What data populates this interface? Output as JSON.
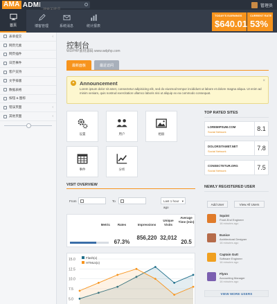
{
  "app": {
    "brand_part1": "AMA",
    "brand_part2": "ADMIN",
    "search_placeholder": "搜索关键词",
    "user_name": "管理员"
  },
  "nav": [
    {
      "label": "首页",
      "icon": "monitor-icon",
      "active": true
    },
    {
      "label": "博客管理",
      "icon": "pen-icon",
      "active": false
    },
    {
      "label": "系统消息",
      "icon": "envelope-icon",
      "active": false
    },
    {
      "label": "统计报表",
      "icon": "bar-chart-icon",
      "active": false
    }
  ],
  "stats": {
    "earnings_label": "TODAY'S EARNINGS",
    "earnings_value": "$640.01",
    "rate_label": "CURRENT RATE",
    "rate_value": "53%"
  },
  "sidebar": {
    "items": [
      {
        "label": "表单提交",
        "caret": "‹"
      },
      {
        "label": "网页元素",
        "caret": ""
      },
      {
        "label": "网页插件",
        "caret": ""
      },
      {
        "label": "日历事件",
        "caret": ""
      },
      {
        "label": "客户支持",
        "caret": ""
      },
      {
        "label": "文字排版",
        "caret": ""
      },
      {
        "label": "数据表格",
        "caret": ""
      },
      {
        "label": "按钮 & 图标",
        "caret": ""
      },
      {
        "label": "错误页面",
        "caret": "‹"
      },
      {
        "label": "其他页面",
        "caret": "‹"
      }
    ]
  },
  "page": {
    "title": "控制台",
    "subtitle": "WDPHP素材源码 www.wdphp.com",
    "tabs": [
      {
        "label": "最新面板",
        "active": true
      },
      {
        "label": "最近访问",
        "active": false
      }
    ]
  },
  "announcement": {
    "title": "Announcement",
    "text": "Lorem ipsum dolor sit amet, consectetur adipisicing elit, sed do eiusmod tempor incididunt ut labore et dolore magna aliqua. Ut enim ad minim veniam, quis nostrud exercitation ullamco laboris nisi ut aliquip ex ea commodo consequat.",
    "close": "×"
  },
  "shortcuts": [
    {
      "label": "设置",
      "icon": "gears-icon"
    },
    {
      "label": "用户",
      "icon": "users-icon"
    },
    {
      "label": "相册",
      "icon": "picture-icon"
    },
    {
      "label": "事件",
      "icon": "calendar-icon"
    },
    {
      "label": "分析",
      "icon": "line-chart-icon"
    }
  ],
  "top_sites": {
    "title": "TOP RATED SITES",
    "items": [
      {
        "name": "LOREMIPSUM.COM",
        "network": "Social Network",
        "score": "8.1"
      },
      {
        "name": "DOLORSITAMET.NET",
        "network": "Social Network",
        "score": "7.8"
      },
      {
        "name": "CONSECTETUR.ORG",
        "network": "Social Network",
        "score": "7.5"
      }
    ]
  },
  "new_users": {
    "title": "NEWLY REGISTERED USER",
    "add_label": "Add User",
    "view_all_label": "View All Users",
    "users": [
      {
        "name": "Squint",
        "role": "Front-End Engineer",
        "time": "16 minutes ago",
        "color": "#e07b2a"
      },
      {
        "name": "Eunice",
        "role": "Architectural Designer",
        "time": "16 minutes ago",
        "color": "#b56b4a"
      },
      {
        "name": "Captain Gutt",
        "role": "Software Engineer",
        "time": "16 minutes ago",
        "color": "#f0a020"
      },
      {
        "name": "Flynn",
        "role": "Accounting Manager",
        "time": "16 minutes ago",
        "color": "#7b5fb0"
      }
    ],
    "view_more": "VIEW MORE USERS"
  },
  "visit_overview": {
    "title": "VISIT OVERVIEW",
    "from_label": "From",
    "to_label": "To",
    "range_select": "Last 1 hour ago",
    "headers": [
      "Metric",
      "Rates",
      "Impressions",
      "Unique Visits",
      "Average Time (min)"
    ],
    "rates": "67.3%",
    "rates_fraction": 0.673,
    "impressions": "856,220",
    "unique_visits": "32,012",
    "average_time": "20.5"
  },
  "chart_data": {
    "type": "area",
    "x": [
      0,
      1,
      2,
      3,
      4,
      5,
      6
    ],
    "ylim": [
      0,
      15
    ],
    "y_ticks": [
      "15.0",
      "12.5",
      "10.0",
      "7.5",
      "5.0"
    ],
    "grid": true,
    "legend_position": "top-left",
    "series": [
      {
        "name": "Flash(x)",
        "color": "#1f6f8b",
        "values": [
          5,
          6.5,
          8,
          10.5,
          13,
          9,
          11
        ]
      },
      {
        "name": "HTML5(x)",
        "color": "#f7941d",
        "values": [
          7,
          9,
          11,
          12.5,
          10,
          6,
          8
        ]
      }
    ]
  }
}
